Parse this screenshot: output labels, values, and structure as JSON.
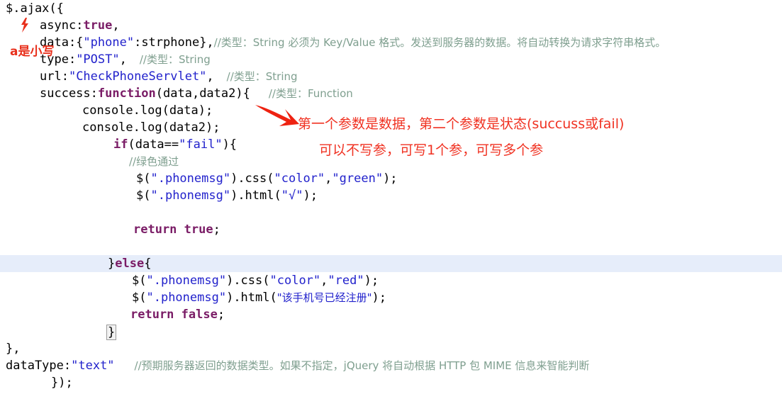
{
  "editor": {
    "language": "javascript",
    "background_color": "#ffffff",
    "highlight_line_color": "#e6edfa",
    "colors": {
      "plain": "#000000",
      "string": "#2222cc",
      "keyword": "#7a1c66",
      "comment": "#7f9f8f",
      "annotation_red": "#f03222"
    }
  },
  "code": {
    "lines": [
      {
        "n": 1,
        "indent": 0,
        "highlight": false,
        "text": "$.ajax({"
      },
      {
        "n": 2,
        "indent": 4,
        "highlight": false,
        "text": "async:true,"
      },
      {
        "n": 3,
        "indent": 4,
        "highlight": false,
        "text": "data:{\"phone\":strphone},//类型：String 必须为 Key/Value 格式。发送到服务器的数据。将自动转换为请求字符串格式。"
      },
      {
        "n": 4,
        "indent": 4,
        "highlight": false,
        "text": "type:\"POST\",  //类型：String"
      },
      {
        "n": 5,
        "indent": 4,
        "highlight": false,
        "text": "url:\"CheckPhoneServlet\",  //类型：String"
      },
      {
        "n": 6,
        "indent": 4,
        "highlight": false,
        "text": "success:function(data,data2){   //类型：Function"
      },
      {
        "n": 7,
        "indent": 8,
        "highlight": false,
        "text": "console.log(data);"
      },
      {
        "n": 8,
        "indent": 8,
        "highlight": false,
        "text": "console.log(data2);"
      },
      {
        "n": 9,
        "indent": 12,
        "highlight": false,
        "text": "if(data==\"fail\"){"
      },
      {
        "n": 10,
        "indent": 14,
        "highlight": false,
        "text": "//绿色通过"
      },
      {
        "n": 11,
        "indent": 14,
        "highlight": false,
        "text": "$(\".phonemsg\").css(\"color\",\"green\");"
      },
      {
        "n": 12,
        "indent": 14,
        "highlight": false,
        "text": "$(\".phonemsg\").html(\"√\");"
      },
      {
        "n": 13,
        "indent": 0,
        "highlight": false,
        "text": ""
      },
      {
        "n": 14,
        "indent": 13,
        "highlight": false,
        "text": "return true;"
      },
      {
        "n": 15,
        "indent": 0,
        "highlight": false,
        "text": ""
      },
      {
        "n": 16,
        "indent": 11,
        "highlight": true,
        "text": "}else{"
      },
      {
        "n": 17,
        "indent": 14,
        "highlight": false,
        "text": "$(\".phonemsg\").css(\"color\",\"red\");"
      },
      {
        "n": 18,
        "indent": 14,
        "highlight": false,
        "text": "$(\".phonemsg\").html(\"该手机号已经注册\");"
      },
      {
        "n": 19,
        "indent": 13,
        "highlight": false,
        "text": "return false;"
      },
      {
        "n": 20,
        "indent": 11,
        "highlight": false,
        "text": "}"
      },
      {
        "n": 21,
        "indent": 0,
        "highlight": false,
        "text": "},"
      },
      {
        "n": 22,
        "indent": 0,
        "highlight": false,
        "text": "dataType:\"text\"   //预期服务器返回的数据类型。如果不指定，jQuery 将自动根据 HTTP 包 MIME 信息来智能判断"
      },
      {
        "n": 23,
        "indent": 4,
        "highlight": false,
        "text": "});"
      }
    ],
    "tokens": {
      "l1": "$.ajax({",
      "l2_key": "async:",
      "l2_true": "true",
      "l2_tail": ",",
      "l3_key": "data:{",
      "l3_str": "\"phone\"",
      "l3_mid": ":strphone},",
      "l3_comment": "//类型：String 必须为 Key/Value 格式。发送到服务器的数据。将自动转换为请求字符串格式。",
      "l4_key": "type:",
      "l4_str": "\"POST\"",
      "l4_tail": ",",
      "l4_comment": "//类型：String",
      "l5_key": "url:",
      "l5_str": "\"CheckPhoneServlet\"",
      "l5_tail": ",",
      "l5_comment": "//类型：String",
      "l6_key": "success:",
      "l6_kw": "function",
      "l6_args": "(data,data2){",
      "l6_comment": "//类型：Function",
      "l7": "console.log(data);",
      "l8": "console.log(data2);",
      "l9_kw": "if",
      "l9_open": "(data==",
      "l9_str": "\"fail\"",
      "l9_close": "){",
      "l10_comment": "//绿色通过",
      "l11_a": "$(",
      "l11_sel": "\".phonemsg\"",
      "l11_b": ").css(",
      "l11_c": "\"color\"",
      "l11_d": ",",
      "l11_e": "\"green\"",
      "l11_f": ");",
      "l12_a": "$(",
      "l12_sel": "\".phonemsg\"",
      "l12_b": ").html(",
      "l12_c": "\"√\"",
      "l12_d": ");",
      "l14_kw": "return",
      "l14_val": "true",
      "l14_tail": ";",
      "l16_a": "}",
      "l16_kw": "else",
      "l16_b": "{",
      "l17_a": "$(",
      "l17_sel": "\".phonemsg\"",
      "l17_b": ").css(",
      "l17_c": "\"color\"",
      "l17_d": ",",
      "l17_e": "\"red\"",
      "l17_f": ");",
      "l18_a": "$(",
      "l18_sel": "\".phonemsg\"",
      "l18_b": ").html(",
      "l18_c": "\"该手机号已经注册\"",
      "l18_d": ");",
      "l19_kw": "return",
      "l19_val": "false",
      "l19_tail": ";",
      "l20": "}",
      "l21": "},",
      "l22_key": "dataType:",
      "l22_str": "\"text\"",
      "l22_comment": "//预期服务器返回的数据类型。如果不指定，jQuery 将自动根据 HTTP 包 MIME 信息来智能判断",
      "l23": "});"
    }
  },
  "annotations": {
    "a_lowercase": "a是小写",
    "params_line1": "第一个参数是数据，第二个参数是状态(succuss或fail)",
    "params_line2": "可以不写参，可写1个参，可写多个参"
  }
}
